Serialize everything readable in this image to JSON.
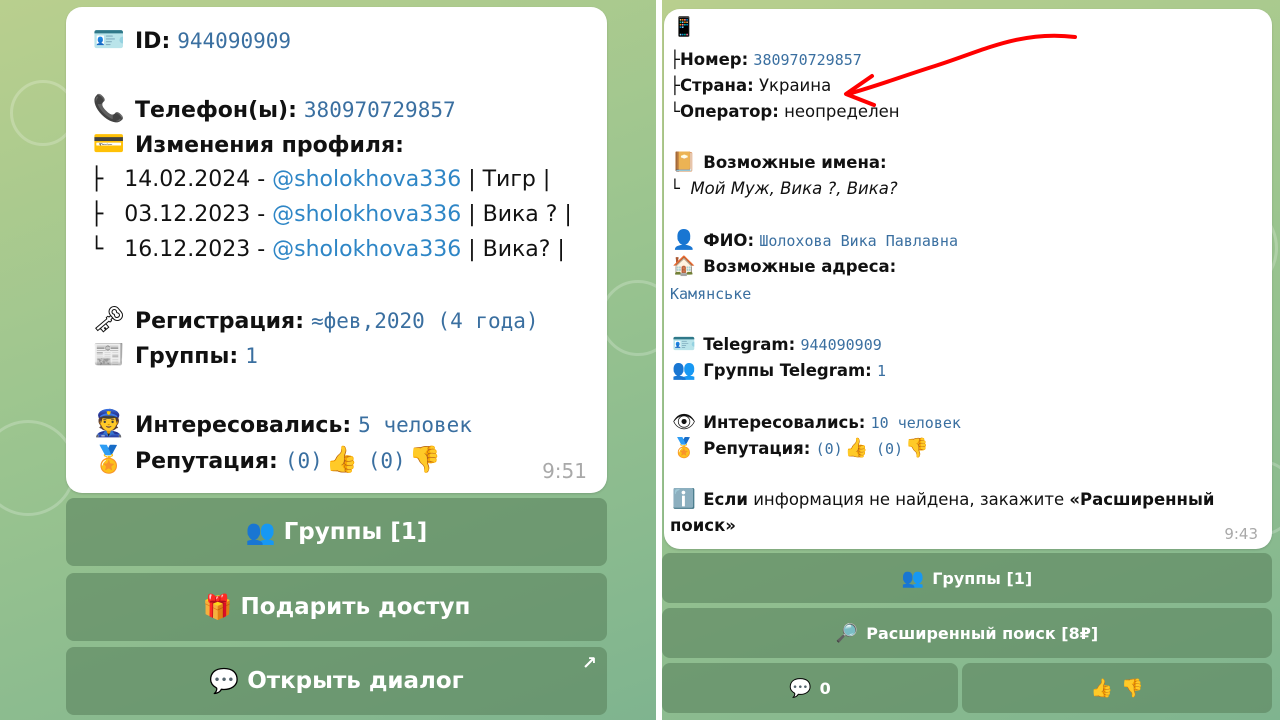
{
  "left": {
    "id_label": "ID:",
    "id_value": "944090909",
    "phone_label": "Телефон(ы):",
    "phone_value": "380970729857",
    "changes_label": "Изменения профиля:",
    "changes": [
      {
        "prefix": "├",
        "date": "14.02.2024 - ",
        "user": "@sholokhova336",
        "name": " | Тигр |"
      },
      {
        "prefix": "├",
        "date": "03.12.2023 - ",
        "user": "@sholokhova336",
        "name": " | Вика ? |"
      },
      {
        "prefix": "└",
        "date": "16.12.2023 - ",
        "user": "@sholokhova336",
        "name": " | Вика? |"
      }
    ],
    "reg_label": "Регистрация:",
    "reg_value": "≈фев,2020 (4 года)",
    "groups_label": "Группы:",
    "groups_value": "1",
    "interested_label": "Интересовались:",
    "interested_value": "5 человек",
    "rep_label": "Репутация:",
    "rep_pos": "(0)",
    "rep_neg": "(0)",
    "time": "9:51",
    "buttons": {
      "groups": "Группы [1]",
      "gift": "Подарить доступ",
      "dialog": "Открыть диалог"
    }
  },
  "right": {
    "number_label": "Номер:",
    "number_value": "380970729857",
    "country_label": "Страна:",
    "country_value": "Украина",
    "operator_label": "Оператор:",
    "operator_value": "неопределен",
    "names_label": "Возможные имена:",
    "names_value": "Мой Муж, Вика ?, Вика?",
    "fio_label": "ФИО:",
    "fio_value": "Шолохова Вика Павлавна",
    "address_label": "Возможные адреса:",
    "address_value": "Камянське",
    "telegram_label": "Telegram:",
    "telegram_value": "944090909",
    "tg_groups_label": "Группы Telegram:",
    "tg_groups_value": "1",
    "interested_label": "Интересовались:",
    "interested_value": "10 человек",
    "rep_label": "Репутация:",
    "rep_pos": "(0)",
    "rep_neg": "(0)",
    "info_bold": "Если",
    "info_text": " информация не найдена, закажите ",
    "info_link": "«Расширенный",
    "info_link2": "поиск»",
    "time": "9:43",
    "buttons": {
      "groups": "Группы [1]",
      "extended": "Расширенный поиск [8₽]",
      "comments": "0"
    }
  },
  "colors": {
    "annotation_arrow": "#ff0000",
    "button_bg": "#5c8460",
    "link": "#2e86c6"
  }
}
